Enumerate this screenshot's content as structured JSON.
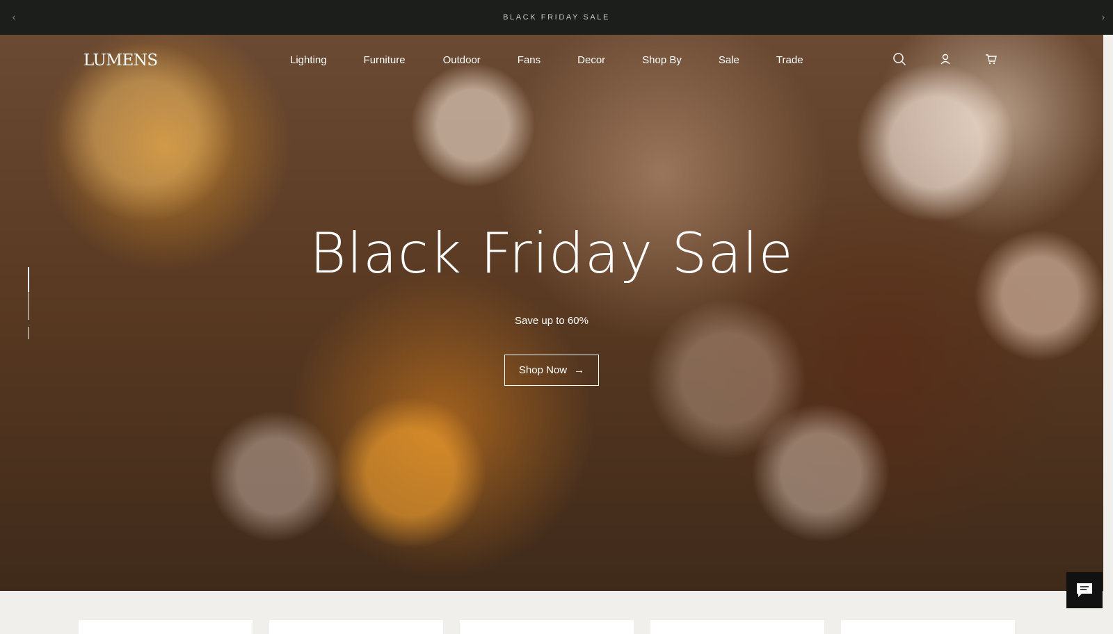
{
  "announcement": {
    "text": "BLACK FRIDAY SALE"
  },
  "brand": {
    "logo": "LUMENS"
  },
  "nav": {
    "items": [
      {
        "label": "Lighting"
      },
      {
        "label": "Furniture"
      },
      {
        "label": "Outdoor"
      },
      {
        "label": "Fans"
      },
      {
        "label": "Decor"
      },
      {
        "label": "Shop By"
      },
      {
        "label": "Sale"
      },
      {
        "label": "Trade"
      }
    ],
    "icons": [
      "search-icon",
      "account-icon",
      "cart-icon"
    ]
  },
  "hero": {
    "title": "Black Friday Sale",
    "subtitle": "Save up to 60%",
    "cta": "Shop Now",
    "slides": 3,
    "active_slide": 1
  },
  "colors": {
    "topbar": "#1c1e1c",
    "text_on_hero": "#ffffff",
    "page_bg": "#f0efeb",
    "chat_bg": "#111111"
  }
}
